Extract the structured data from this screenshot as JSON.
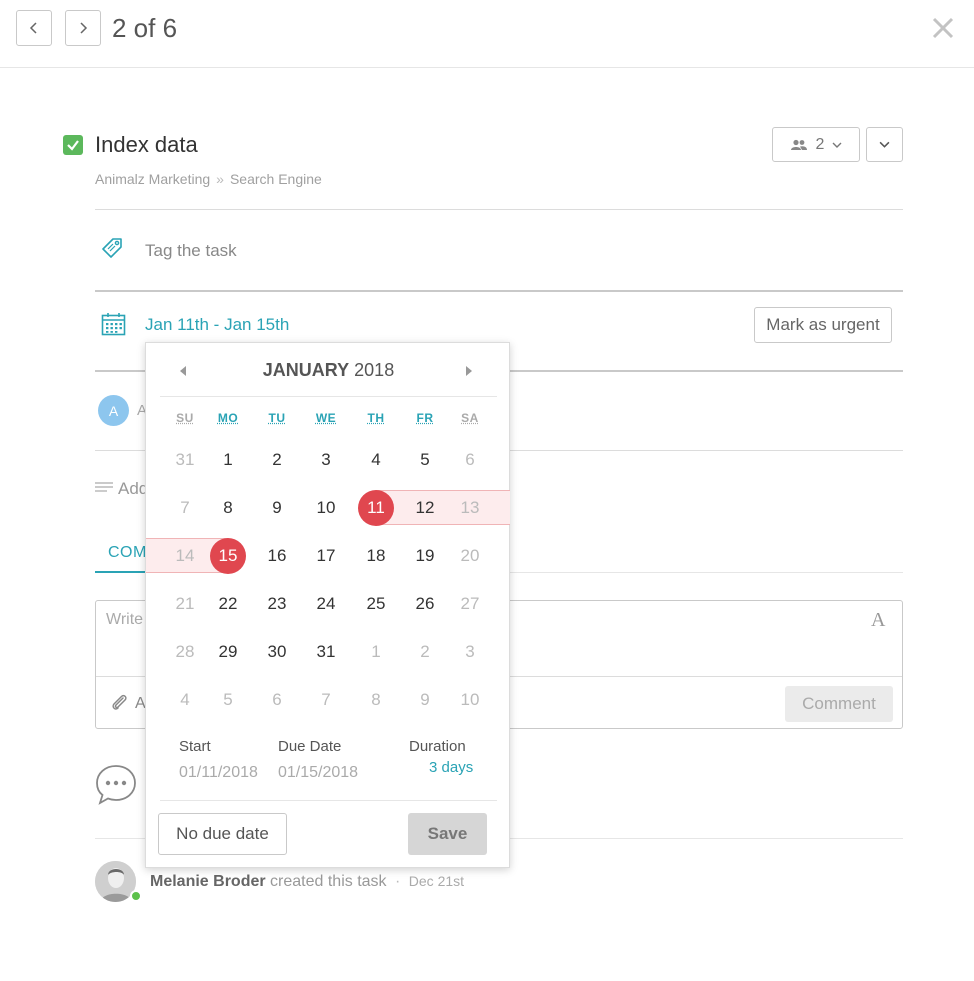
{
  "nav": {
    "pager_text": "2 of 6"
  },
  "task": {
    "title": "Index data",
    "breadcrumb": [
      "Animalz Marketing",
      "Search Engine"
    ],
    "breadcrumb_sep": "»",
    "members_count": "2",
    "completed": true
  },
  "tag": {
    "placeholder": "Tag the task"
  },
  "dates": {
    "range_label": "Jan 11th - Jan 15th",
    "urgent_label": "Mark as urgent"
  },
  "assignee": {
    "avatar_initial": "A",
    "partial_text": "A"
  },
  "description": {
    "partial_text": "Add"
  },
  "tabs": {
    "comments_partial": "COM"
  },
  "comment": {
    "placeholder_partial": "Write",
    "attach_partial": "A",
    "format_glyph": "A",
    "submit_label": "Comment"
  },
  "activity": {
    "user": "Melanie Broder",
    "action": "created this task",
    "sep": "·",
    "date": "Dec 21st"
  },
  "datepicker": {
    "month": "JANUARY",
    "year": "2018",
    "weekdays": [
      "SU",
      "MO",
      "TU",
      "WE",
      "TH",
      "FR",
      "SA"
    ],
    "weeks": [
      [
        {
          "d": "31",
          "m": true
        },
        {
          "d": "1"
        },
        {
          "d": "2"
        },
        {
          "d": "3"
        },
        {
          "d": "4"
        },
        {
          "d": "5"
        },
        {
          "d": "6",
          "m": true
        }
      ],
      [
        {
          "d": "7",
          "m": true
        },
        {
          "d": "8"
        },
        {
          "d": "9"
        },
        {
          "d": "10"
        },
        {
          "d": "11",
          "s": true
        },
        {
          "d": "12"
        },
        {
          "d": "13",
          "m": true
        }
      ],
      [
        {
          "d": "14",
          "m": true
        },
        {
          "d": "15",
          "s": true
        },
        {
          "d": "16"
        },
        {
          "d": "17"
        },
        {
          "d": "18"
        },
        {
          "d": "19"
        },
        {
          "d": "20",
          "m": true
        }
      ],
      [
        {
          "d": "21",
          "m": true
        },
        {
          "d": "22"
        },
        {
          "d": "23"
        },
        {
          "d": "24"
        },
        {
          "d": "25"
        },
        {
          "d": "26"
        },
        {
          "d": "27",
          "m": true
        }
      ],
      [
        {
          "d": "28",
          "m": true
        },
        {
          "d": "29"
        },
        {
          "d": "30"
        },
        {
          "d": "31"
        },
        {
          "d": "1",
          "m": true
        },
        {
          "d": "2",
          "m": true
        },
        {
          "d": "3",
          "m": true
        }
      ],
      [
        {
          "d": "4",
          "m": true
        },
        {
          "d": "5",
          "m": true
        },
        {
          "d": "6",
          "m": true
        },
        {
          "d": "7",
          "m": true
        },
        {
          "d": "8",
          "m": true
        },
        {
          "d": "9",
          "m": true
        },
        {
          "d": "10",
          "m": true
        }
      ]
    ],
    "start_label": "Start",
    "due_label": "Due Date",
    "duration_label": "Duration",
    "start_value": "01/11/2018",
    "due_value": "01/15/2018",
    "duration_value": "3 days",
    "no_due_label": "No due date",
    "save_label": "Save"
  },
  "colors": {
    "accent": "#2aa3b5",
    "selected": "#e0474f",
    "range_fill": "#fdeced",
    "success": "#5cb85c"
  }
}
